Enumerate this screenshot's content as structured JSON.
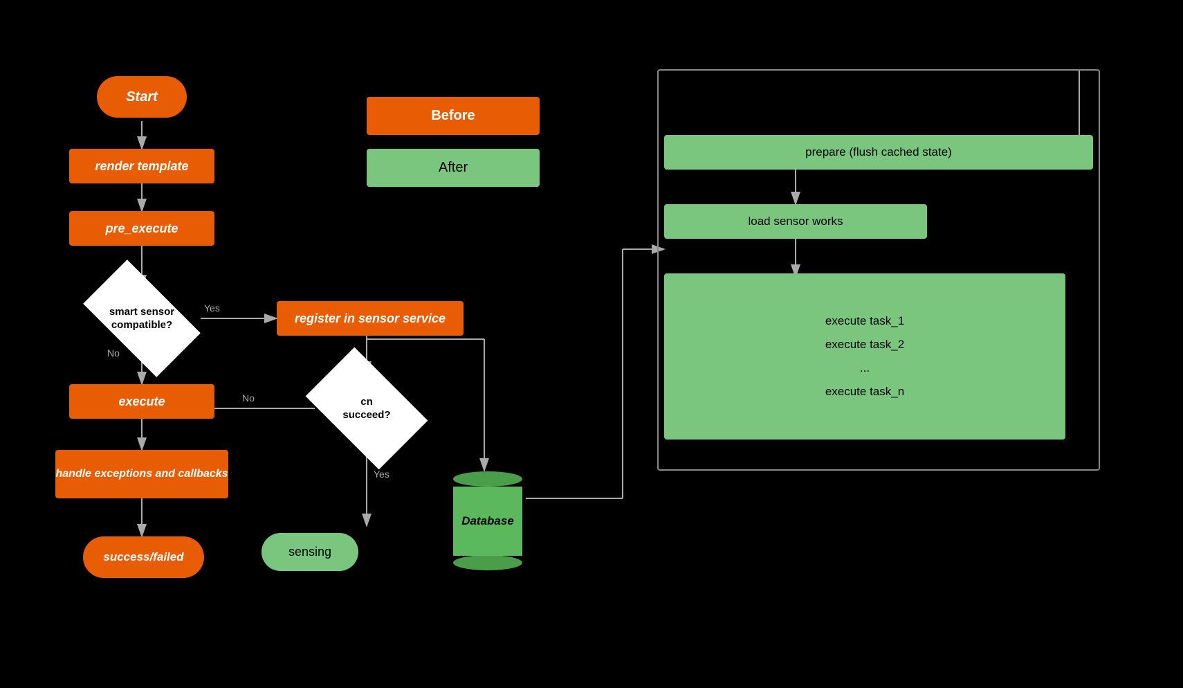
{
  "shapes": {
    "start": "Start",
    "render_template": "render template",
    "pre_execute": "pre_execute",
    "smart_sensor": "smart sensor\ncompatible?",
    "execute": "execute",
    "handle_exceptions": "handle exceptions and\ncallbacks",
    "success_failed": "success/failed",
    "register_sensor": "register in sensor service",
    "cn_succeed": "cn\nsucceed?",
    "sensing": "sensing",
    "before_label": "Before",
    "after_label": "After",
    "prepare": "prepare (flush cached state)",
    "load_sensor": "load sensor works",
    "tasks": "execute task_1\nexecute task_2\n...\nexecute task_n",
    "database": "Database"
  }
}
